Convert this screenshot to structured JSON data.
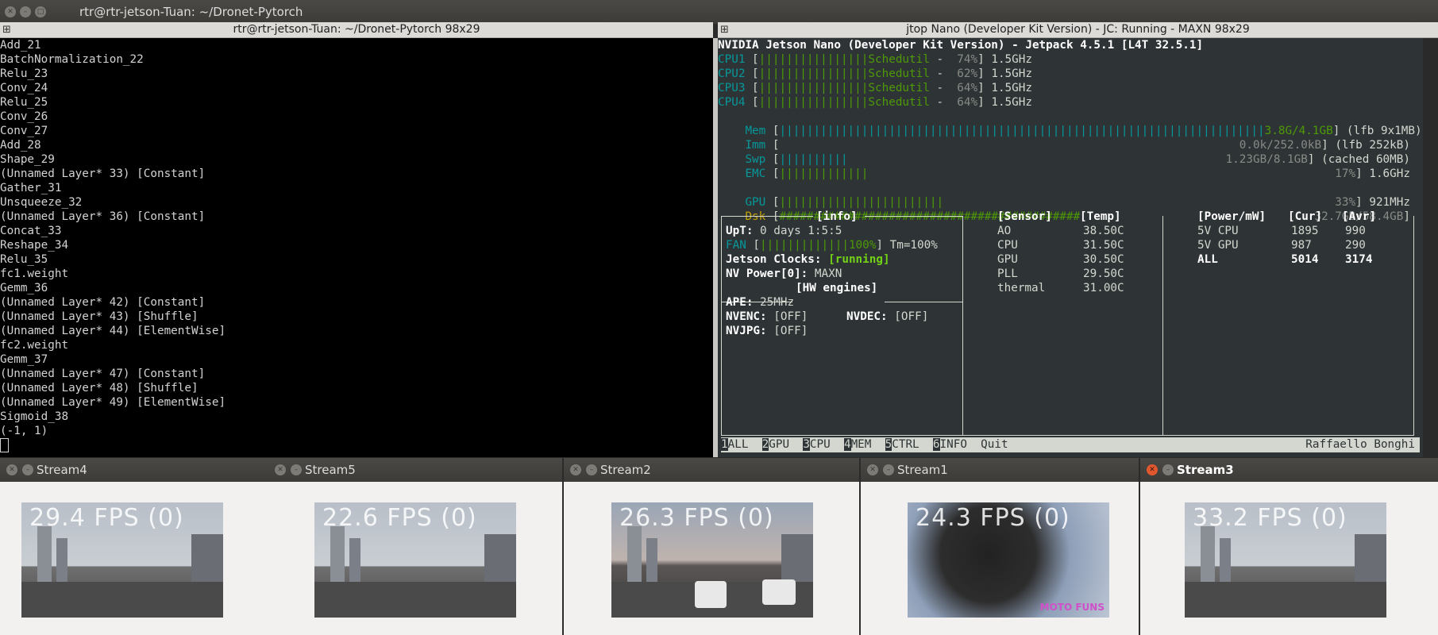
{
  "outer_window": {
    "title": "rtr@rtr-jetson-Tuan: ~/Dronet-Pytorch"
  },
  "left_pane": {
    "header": "rtr@rtr-jetson-Tuan: ~/Dronet-Pytorch 98x29",
    "lines": [
      "Add_21",
      "BatchNormalization_22",
      "Relu_23",
      "Conv_24",
      "Relu_25",
      "Conv_26",
      "Conv_27",
      "Add_28",
      "Shape_29",
      "(Unnamed Layer* 33) [Constant]",
      "Gather_31",
      "Unsqueeze_32",
      "(Unnamed Layer* 36) [Constant]",
      "Concat_33",
      "Reshape_34",
      "Relu_35",
      "fc1.weight",
      "Gemm_36",
      "(Unnamed Layer* 42) [Constant]",
      "(Unnamed Layer* 43) [Shuffle]",
      "(Unnamed Layer* 44) [ElementWise]",
      "fc2.weight",
      "Gemm_37",
      "(Unnamed Layer* 47) [Constant]",
      "(Unnamed Layer* 48) [Shuffle]",
      "(Unnamed Layer* 49) [ElementWise]",
      "Sigmoid_38",
      "(-1, 1)"
    ]
  },
  "right_pane": {
    "header": "jtop Nano (Developer Kit Version) - JC: Running - MAXN 98x29",
    "heading": "NVIDIA Jetson Nano (Developer Kit Version) - Jetpack 4.5.1 [L4T 32.5.1]",
    "cpus": [
      {
        "label": "CPU1",
        "gov": "Schedutil",
        "pct": "74%",
        "freq": "1.5GHz"
      },
      {
        "label": "CPU2",
        "gov": "Schedutil",
        "pct": "62%",
        "freq": "1.5GHz"
      },
      {
        "label": "CPU3",
        "gov": "Schedutil",
        "pct": "64%",
        "freq": "1.5GHz"
      },
      {
        "label": "CPU4",
        "gov": "Schedutil",
        "pct": "64%",
        "freq": "1.5GHz"
      }
    ],
    "mem": {
      "label": "Mem",
      "value": "3.8G/4.1GB",
      "extra": "(lfb 9x1MB)"
    },
    "imm": {
      "label": "Imm",
      "value": "0.0k/252.0kB",
      "extra": "(lfb 252kB)"
    },
    "swp": {
      "label": "Swp",
      "value": "1.23GB/8.1GB",
      "extra": "(cached 60MB)"
    },
    "emc": {
      "label": "EMC",
      "value": "17%",
      "extra": "1.6GHz"
    },
    "gpu": {
      "label": "GPU",
      "value": "33%",
      "extra": "921MHz"
    },
    "dsk": {
      "label": "Dsk",
      "value": "32.7GB/58.4GB"
    },
    "info": {
      "title": "[info]",
      "uptime_label": "UpT:",
      "uptime": "0 days 1:5:5",
      "fan_label": "FAN",
      "fan_pct": "100%",
      "fan_tm": "Tm=100%",
      "clocks_label": "Jetson Clocks:",
      "clocks": "[running]",
      "nvp_label": "NV Power[0]:",
      "nvp": "MAXN",
      "hw_title": "[HW engines]",
      "ape_label": "APE:",
      "ape": "25MHz",
      "nvenc_label": "NVENC:",
      "nvenc": "[OFF]",
      "nvdec_label": "NVDEC:",
      "nvdec": "[OFF]",
      "nvjpg_label": "NVJPG:",
      "nvjpg": "[OFF]"
    },
    "sensors": {
      "h1": "[Sensor]",
      "h2": "[Temp]",
      "rows": [
        {
          "name": "AO",
          "temp": "38.50C"
        },
        {
          "name": "CPU",
          "temp": "31.50C"
        },
        {
          "name": "GPU",
          "temp": "30.50C"
        },
        {
          "name": "PLL",
          "temp": "29.50C"
        },
        {
          "name": "thermal",
          "temp": "31.00C"
        }
      ]
    },
    "power": {
      "h1": "[Power/mW]",
      "h2": "[Cur]",
      "h3": "[Avr]",
      "rows": [
        {
          "name": "5V CPU",
          "cur": "1895",
          "avr": "990"
        },
        {
          "name": "5V GPU",
          "cur": "987",
          "avr": "290"
        },
        {
          "name": "ALL",
          "cur": "5014",
          "avr": "3174"
        }
      ]
    },
    "menu": [
      {
        "key": "1",
        "label": "ALL"
      },
      {
        "key": "2",
        "label": "GPU"
      },
      {
        "key": "3",
        "label": "CPU"
      },
      {
        "key": "4",
        "label": "MEM"
      },
      {
        "key": "5",
        "label": "CTRL"
      },
      {
        "key": "6",
        "label": "INFO"
      },
      {
        "key": "",
        "label": "Quit"
      }
    ],
    "author": "Raffaello Bonghi"
  },
  "streams": [
    {
      "title": "Stream4",
      "fps": "29.4 FPS (0)"
    },
    {
      "title": "Stream5",
      "fps": "22.6 FPS (0)"
    },
    {
      "title": "Stream2",
      "fps": "26.3 FPS (0)"
    },
    {
      "title": "Stream1",
      "fps": "24.3 FPS (0)",
      "overlay": "MOTO FUNS"
    },
    {
      "title": "Stream3",
      "fps": "33.2 FPS (0)"
    }
  ]
}
